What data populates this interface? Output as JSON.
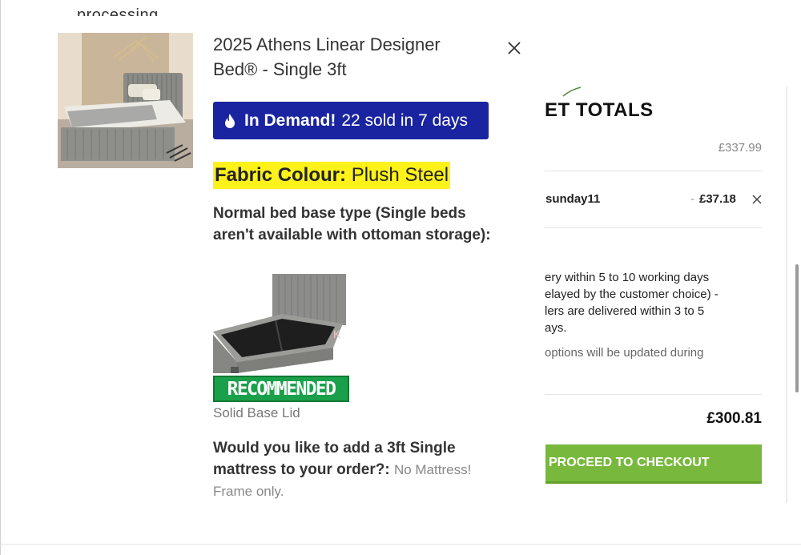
{
  "popup": {
    "clipped_top_text": "processing",
    "product_title": "2025 Athens Linear Designer Bed® - Single 3ft",
    "demand_strong": "In Demand!",
    "demand_text": "22 sold in 7 days",
    "fabric_label": "Fabric Colour:",
    "fabric_value": "Plush Steel",
    "base_question": "Normal bed base type (Single beds aren't available with ottoman storage):",
    "base_badge": "RECOMMENDED",
    "base_option": "Solid Base Lid",
    "mattress_question": "Would you like to add a 3ft Single mattress to your order?:",
    "mattress_answer": "No Mattress! Frame only.",
    "colors": {
      "demand_bg": "#1a24a0",
      "highlight": "#fff21a",
      "recommended_bg": "#1aa04a"
    }
  },
  "basket": {
    "title": "ET TOTALS",
    "subtotal_value": "£337.99",
    "coupon_code": "sunday11",
    "coupon_dash": "-",
    "coupon_amount": "£37.18",
    "delivery_line1": "ery within 5 to 10 working days",
    "delivery_line2": "elayed by the customer choice) -",
    "delivery_line3": "lers are delivered within 3 to 5",
    "delivery_line4": "ays.",
    "options_text": "options will be updated during",
    "total_value": "£300.81",
    "checkout_label": "PROCEED TO CHECKOUT",
    "colors": {
      "checkout_bg": "#78b83c"
    }
  },
  "icons": {
    "close": "close-icon",
    "flame": "flame-icon",
    "coupon_remove": "close-icon"
  }
}
